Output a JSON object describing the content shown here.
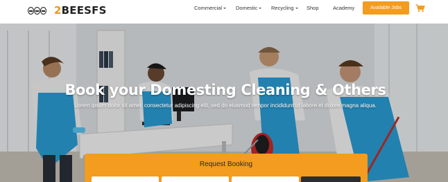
{
  "brand": {
    "prefix": "2",
    "name": "BEESFS"
  },
  "nav": {
    "items": [
      {
        "label": "Commercial",
        "has_dropdown": true
      },
      {
        "label": "Domestic",
        "has_dropdown": true
      },
      {
        "label": "Recycling",
        "has_dropdown": true
      },
      {
        "label": "Shop",
        "has_dropdown": false
      },
      {
        "label": "Academy",
        "has_dropdown": false
      }
    ],
    "cta_label": "Available Jobs",
    "cart_icon": "cart-icon"
  },
  "hero": {
    "title": "Book your Domesting Cleaning & Others",
    "subtitle": "Lorem ipsum dolor sit amet, consectetur adipiscing elit, sed do eiusmod tempor incididunt ut labore et dolore magna aliqua."
  },
  "booking": {
    "title": "Request Booking"
  },
  "colors": {
    "accent": "#f39c1f",
    "dark": "#2d2d2d",
    "apron": "#2a9ed6"
  }
}
